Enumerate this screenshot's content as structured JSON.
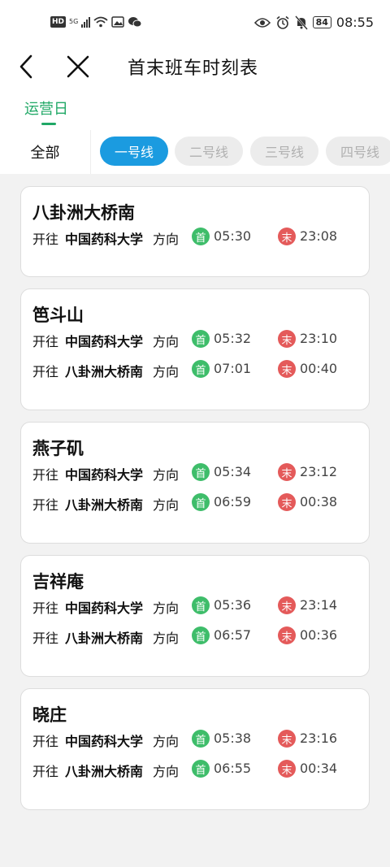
{
  "status_bar": {
    "hd": "HD",
    "network": "5G",
    "battery": "84",
    "time": "08:55"
  },
  "header": {
    "title": "首末班车时刻表"
  },
  "day_tab": "运营日",
  "all_tab": "全部",
  "lines": [
    "一号线",
    "二号线",
    "三号线",
    "四号线"
  ],
  "labels": {
    "towards": "开往",
    "direction": "方向",
    "first": "首",
    "last": "末"
  },
  "stations": [
    {
      "name": "八卦洲大桥南",
      "rows": [
        {
          "dest": "中国药科大学",
          "first": "05:30",
          "last": "23:08"
        }
      ]
    },
    {
      "name": "笆斗山",
      "rows": [
        {
          "dest": "中国药科大学",
          "first": "05:32",
          "last": "23:10"
        },
        {
          "dest": "八卦洲大桥南",
          "first": "07:01",
          "last": "00:40"
        }
      ]
    },
    {
      "name": "燕子矶",
      "rows": [
        {
          "dest": "中国药科大学",
          "first": "05:34",
          "last": "23:12"
        },
        {
          "dest": "八卦洲大桥南",
          "first": "06:59",
          "last": "00:38"
        }
      ]
    },
    {
      "name": "吉祥庵",
      "rows": [
        {
          "dest": "中国药科大学",
          "first": "05:36",
          "last": "23:14"
        },
        {
          "dest": "八卦洲大桥南",
          "first": "06:57",
          "last": "00:36"
        }
      ]
    },
    {
      "name": "晓庄",
      "rows": [
        {
          "dest": "中国药科大学",
          "first": "05:38",
          "last": "23:16"
        },
        {
          "dest": "八卦洲大桥南",
          "first": "06:55",
          "last": "00:34"
        }
      ]
    }
  ]
}
